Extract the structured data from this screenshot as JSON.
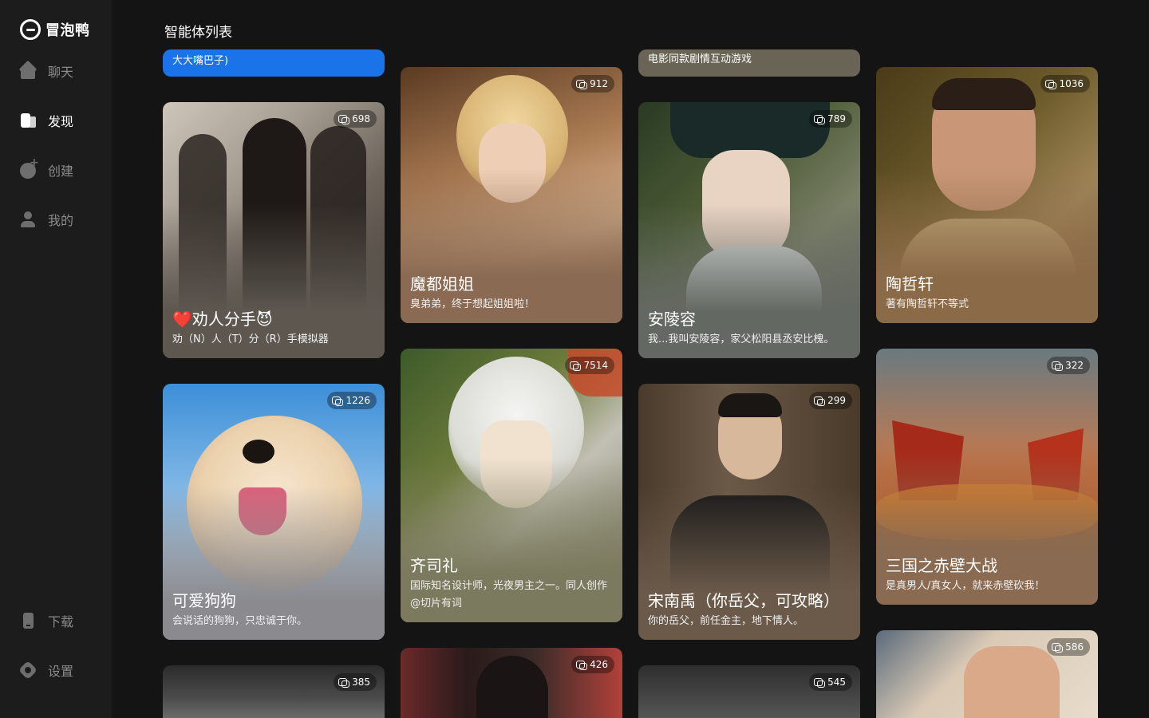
{
  "app": {
    "logo_text": "冒泡鸭",
    "page_title": "智能体列表"
  },
  "sidebar": {
    "items": [
      {
        "label": "聊天",
        "icon": "chat-home-icon",
        "active": false
      },
      {
        "label": "发现",
        "icon": "discover-icon",
        "active": true
      },
      {
        "label": "创建",
        "icon": "create-icon",
        "active": false
      },
      {
        "label": "我的",
        "icon": "profile-icon",
        "active": false
      }
    ],
    "bottom": [
      {
        "label": "下载",
        "icon": "download-icon"
      },
      {
        "label": "设置",
        "icon": "settings-icon"
      }
    ]
  },
  "cards": [
    {
      "name": "",
      "desc": "大大嘴巴子)",
      "count": "",
      "theme": "#1a73e8"
    },
    {
      "name": "❤️劝人分手😈",
      "desc": "劝（N）人（T）分（R）手模拟器",
      "count": "698",
      "theme": "#5d5750"
    },
    {
      "name": "可爱狗狗",
      "desc": "会说话的狗狗，只忠诚于你。",
      "count": "1226",
      "theme": "#8a8a8f"
    },
    {
      "name": "",
      "desc": "",
      "count": "385",
      "theme": "#3a3a3a"
    },
    {
      "name": "魔都姐姐",
      "desc": "臭弟弟，终于想起姐姐啦！",
      "count": "912",
      "theme": "#8a6a52"
    },
    {
      "name": "齐司礼",
      "desc": "国际知名设计师，光夜男主之一。同人创作@切片有词",
      "count": "7514",
      "theme": "#7b7a5e"
    },
    {
      "name": "",
      "desc": "",
      "count": "426",
      "theme": "#3b2a2a"
    },
    {
      "name": "",
      "desc": "电影同款剧情互动游戏",
      "count": "",
      "theme": "#6a6456"
    },
    {
      "name": "安陵容",
      "desc": "我...我叫安陵容，家父松阳县丞安比槐。",
      "count": "789",
      "theme": "#646862"
    },
    {
      "name": "宋南禹（你岳父，可攻略）",
      "desc": "你的岳父，前任金主，地下情人。",
      "count": "299",
      "theme": "#6b5a4a"
    },
    {
      "name": "",
      "desc": "",
      "count": "545",
      "theme": "#3a3a3a"
    },
    {
      "name": "陶哲轩",
      "desc": "著有陶哲轩不等式",
      "count": "1036",
      "theme": "#8b6a48"
    },
    {
      "name": "三国之赤壁大战",
      "desc": "是真男人/真女人，就来赤壁砍我！",
      "count": "322",
      "theme": "#8a6a50"
    },
    {
      "name": "",
      "desc": "",
      "count": "586",
      "theme": "#d9c9b5"
    }
  ]
}
